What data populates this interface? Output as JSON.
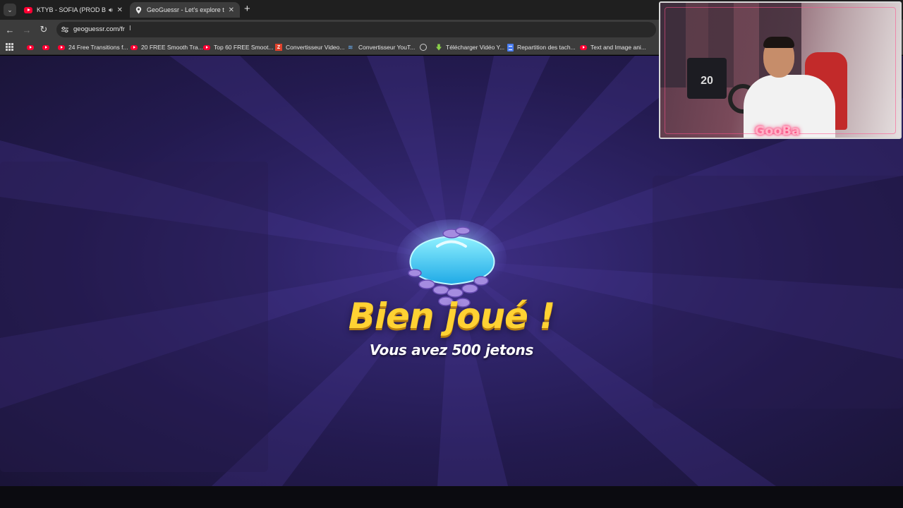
{
  "browser": {
    "tabs": [
      {
        "title": "KTYB - SOFIA (PROD BY GA",
        "favicon": "youtube-icon",
        "audio": true,
        "active": false
      },
      {
        "title": "GeoGuessr - Let's explore the w",
        "favicon": "geoguessr-pin-icon",
        "audio": false,
        "active": true
      }
    ],
    "url": "geoguessr.com/fr",
    "bookmarks": [
      {
        "label": "",
        "favicon": "youtube-icon"
      },
      {
        "label": "",
        "favicon": "youtube-icon"
      },
      {
        "label": "24 Free Transitions f...",
        "favicon": "youtube-icon"
      },
      {
        "label": "20 FREE Smooth Tra...",
        "favicon": "youtube-icon"
      },
      {
        "label": "Top 60 FREE Smoot...",
        "favicon": "youtube-icon"
      },
      {
        "label": "Convertisseur Video...",
        "favicon": "z-icon"
      },
      {
        "label": "Convertisseur YouT...",
        "favicon": "s-icon"
      },
      {
        "label": "",
        "favicon": "globe-icon"
      },
      {
        "label": "Télécharger Vidéo Y...",
        "favicon": "download-arrow-icon"
      },
      {
        "label": "Repartition des tach...",
        "favicon": "docs-icon"
      },
      {
        "label": "Text and Image ani...",
        "favicon": "youtube-icon"
      }
    ]
  },
  "reward": {
    "title": "Bien joué !",
    "subtitle": "Vous avez 500 jetons",
    "icon": "coin-chest-icon"
  },
  "webcam": {
    "logo_text": "GooBa",
    "jersey_number": "20"
  },
  "colors": {
    "title": "#ffd233",
    "background": "#2f2469",
    "youtube": "#ff0033"
  }
}
